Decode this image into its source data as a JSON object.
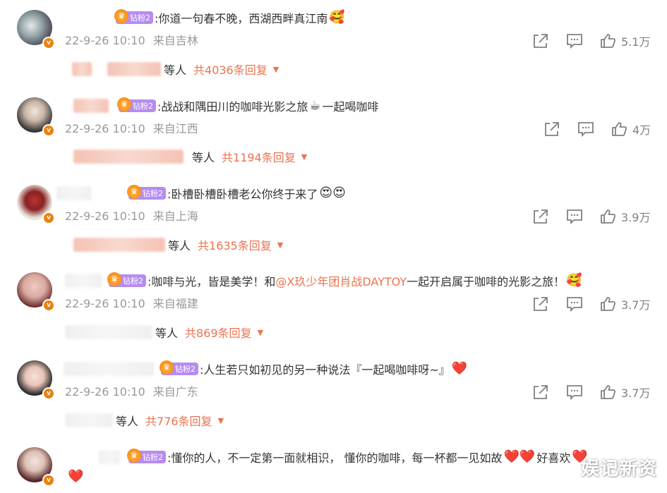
{
  "fan_badge_label": "钻粉2",
  "reply_suffix": "等人",
  "comments": [
    {
      "text": ":你道一句春不晚，西湖西畔真江南",
      "emoji_after": "🥰",
      "date": "22-9-26 10:10",
      "location": "来自吉林",
      "likes": "5.1万",
      "replies": "共4036条回复"
    },
    {
      "text": ":战战和隅田川的咖啡光影之旅",
      "emoji_mid": "☕",
      "text_after": "一起喝咖啡",
      "date": "22-9-26 10:10",
      "location": "来自江西",
      "likes": "4万",
      "replies": "共1194条回复"
    },
    {
      "text": ":卧槽卧槽卧槽老公你终于来了",
      "emoji_after": "😍😍",
      "date": "22-9-26 10:10",
      "location": "来自上海",
      "likes": "3.9万",
      "replies": "共1635条回复"
    },
    {
      "text": ":咖啡与光，皆是美学！和",
      "mention": "@X玖少年团肖战DAYTOY",
      "text_after": " 一起开启属于咖啡的光影之旅！",
      "emoji_after": "🥰",
      "date": "22-9-26 10:10",
      "location": "来自福建",
      "likes": "3.7万",
      "replies": "共869条回复"
    },
    {
      "text": ":人生若只如初见的另一种说法『一起喝咖啡呀~』",
      "emoji_after": "❤️",
      "date": "22-9-26 10:10",
      "location": "来自广东",
      "likes": "3.7万",
      "replies": "共776条回复"
    },
    {
      "text": ":懂你的人，不一定第一面就相识， 懂你的咖啡，每一杯都一见如故",
      "emoji_after": "❤️❤️",
      "text_after": "好喜欢",
      "emoji_end": "❤️",
      "emoji_line2": "❤️"
    }
  ],
  "watermark": "娱记新资",
  "colors": {
    "accent": "#eb7350",
    "meta": "#999999",
    "badge": "#b68cf0",
    "vbadge": "#e8830f"
  },
  "icons": [
    "share-icon",
    "comment-icon",
    "like-icon",
    "caret-down-icon",
    "verified-icon",
    "crown-icon"
  ]
}
